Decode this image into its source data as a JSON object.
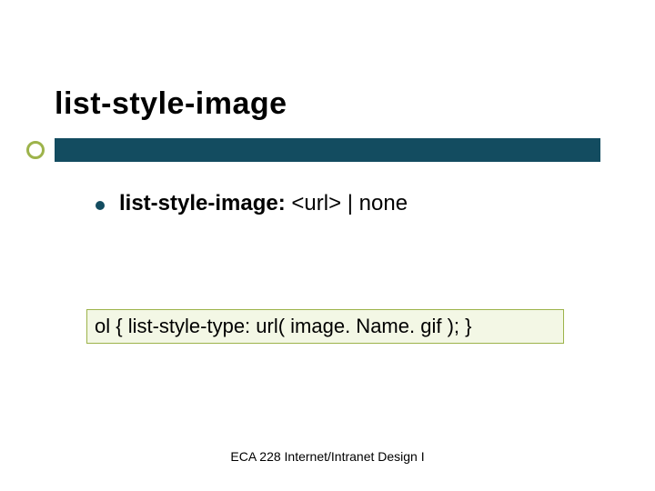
{
  "title": "list-style-image",
  "bullet": {
    "label": "list-style-image:",
    "values": "  <url> | none"
  },
  "code": "ol { list-style-type: url( image. Name. gif ); }",
  "footer": "ECA 228  Internet/Intranet Design I"
}
